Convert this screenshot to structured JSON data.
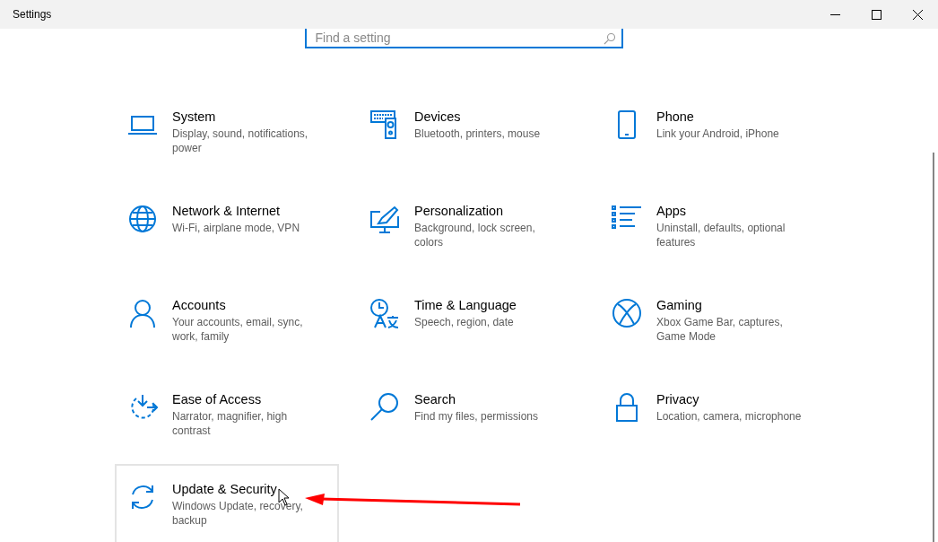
{
  "window": {
    "title": "Settings"
  },
  "search": {
    "placeholder": "Find a setting"
  },
  "categories": [
    {
      "kind": "laptop",
      "title": "System",
      "description": "Display, sound, notifications, power",
      "hovered": false
    },
    {
      "kind": "devices",
      "title": "Devices",
      "description": "Bluetooth, printers, mouse",
      "hovered": false
    },
    {
      "kind": "phone",
      "title": "Phone",
      "description": "Link your Android, iPhone",
      "hovered": false
    },
    {
      "kind": "globe",
      "title": "Network & Internet",
      "description": "Wi-Fi, airplane mode, VPN",
      "hovered": false
    },
    {
      "kind": "brush",
      "title": "Personalization",
      "description": "Background, lock screen, colors",
      "hovered": false
    },
    {
      "kind": "list",
      "title": "Apps",
      "description": "Uninstall, defaults, optional features",
      "hovered": false
    },
    {
      "kind": "person",
      "title": "Accounts",
      "description": "Your accounts, email, sync, work, family",
      "hovered": false
    },
    {
      "kind": "clock",
      "title": "Time & Language",
      "description": "Speech, region, date",
      "hovered": false
    },
    {
      "kind": "xbox",
      "title": "Gaming",
      "description": "Xbox Game Bar, captures, Game Mode",
      "hovered": false
    },
    {
      "kind": "access",
      "title": "Ease of Access",
      "description": "Narrator, magnifier, high contrast",
      "hovered": false
    },
    {
      "kind": "search",
      "title": "Search",
      "description": "Find my files, permissions",
      "hovered": false
    },
    {
      "kind": "lock",
      "title": "Privacy",
      "description": "Location, camera, microphone",
      "hovered": false
    },
    {
      "kind": "sync",
      "title": "Update & Security",
      "description": "Windows Update, recovery, backup",
      "hovered": true
    }
  ]
}
